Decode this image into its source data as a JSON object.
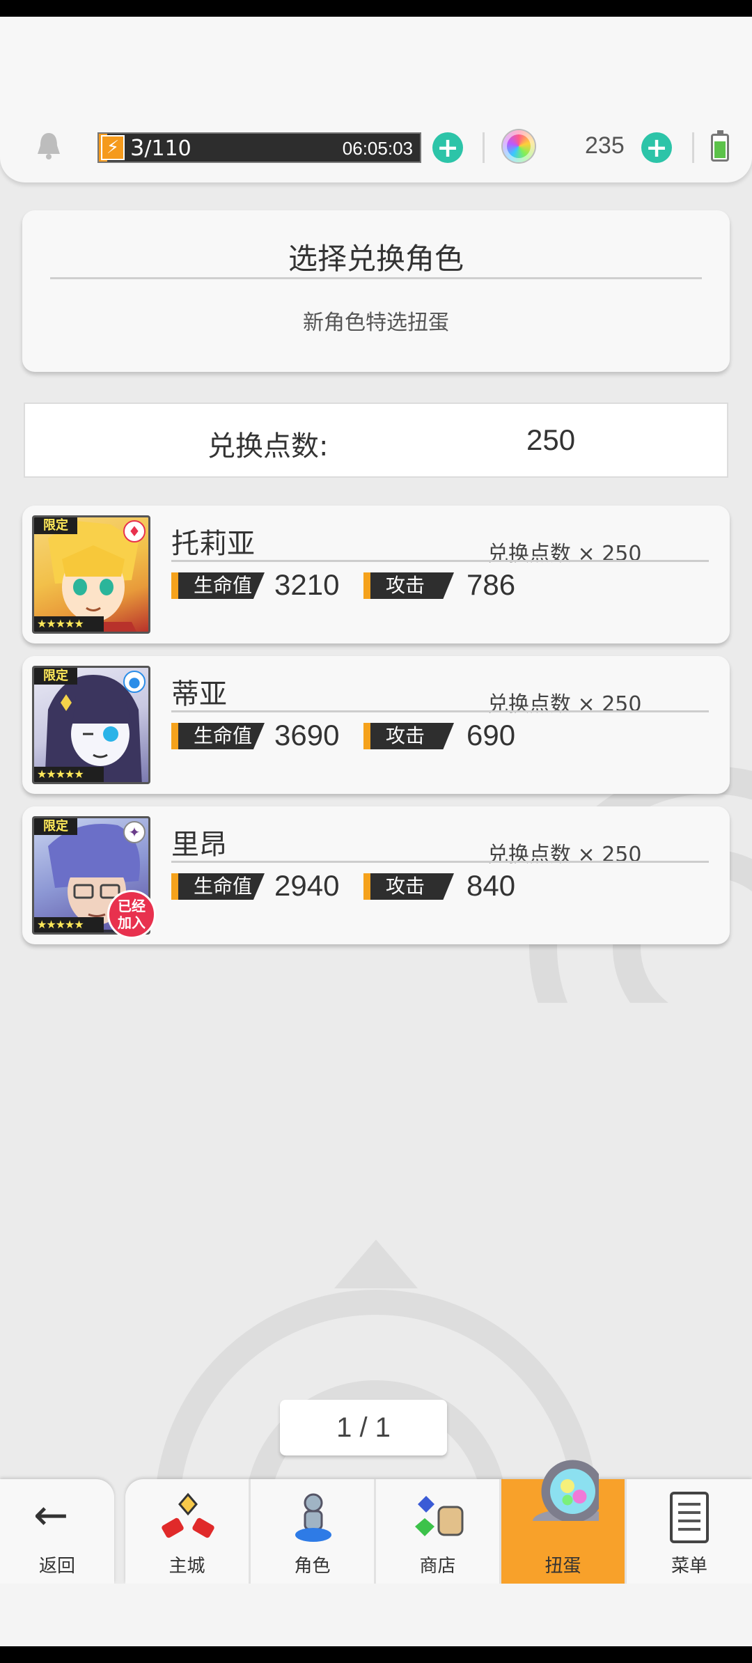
{
  "header": {
    "energy_current": "3",
    "energy_max": "/110",
    "energy_fraction": 0.027,
    "energy_timer": "06:05:03",
    "gem_count": "235"
  },
  "title_card": {
    "title": "选择兑换角色",
    "subtitle": "新角色特选扭蛋"
  },
  "points": {
    "label": "兑换点数:",
    "value": "250"
  },
  "characters": [
    {
      "name": "托莉亚",
      "cost": "兑换点数 × 250",
      "hp_label": "生命值",
      "hp": "3210",
      "atk_label": "攻击",
      "atk": "786",
      "limited": "限定",
      "stars": "★★★★★",
      "element": "fire-icon"
    },
    {
      "name": "蒂亚",
      "cost": "兑换点数 × 250",
      "hp_label": "生命值",
      "hp": "3690",
      "atk_label": "攻击",
      "atk": "690",
      "limited": "限定",
      "stars": "★★★★★",
      "element": "water-icon"
    },
    {
      "name": "里昂",
      "cost": "兑换点数 × 250",
      "hp_label": "生命值",
      "hp": "2940",
      "atk_label": "攻击",
      "atk": "840",
      "limited": "限定",
      "stars": "★★★★★",
      "element": "dark-icon",
      "badge": "已经加入"
    }
  ],
  "pager": "1 / 1",
  "nav": {
    "back": "返回",
    "tabs": [
      {
        "label": "主城",
        "icon": "town-icon"
      },
      {
        "label": "角色",
        "icon": "character-icon"
      },
      {
        "label": "商店",
        "icon": "shop-icon"
      },
      {
        "label": "扭蛋",
        "icon": "gacha-icon",
        "active": true
      },
      {
        "label": "菜单",
        "icon": "menu-icon"
      }
    ]
  },
  "colors": {
    "accent": "#f8a12a",
    "plus": "#2cc4a8",
    "badge": "#e8314e"
  }
}
